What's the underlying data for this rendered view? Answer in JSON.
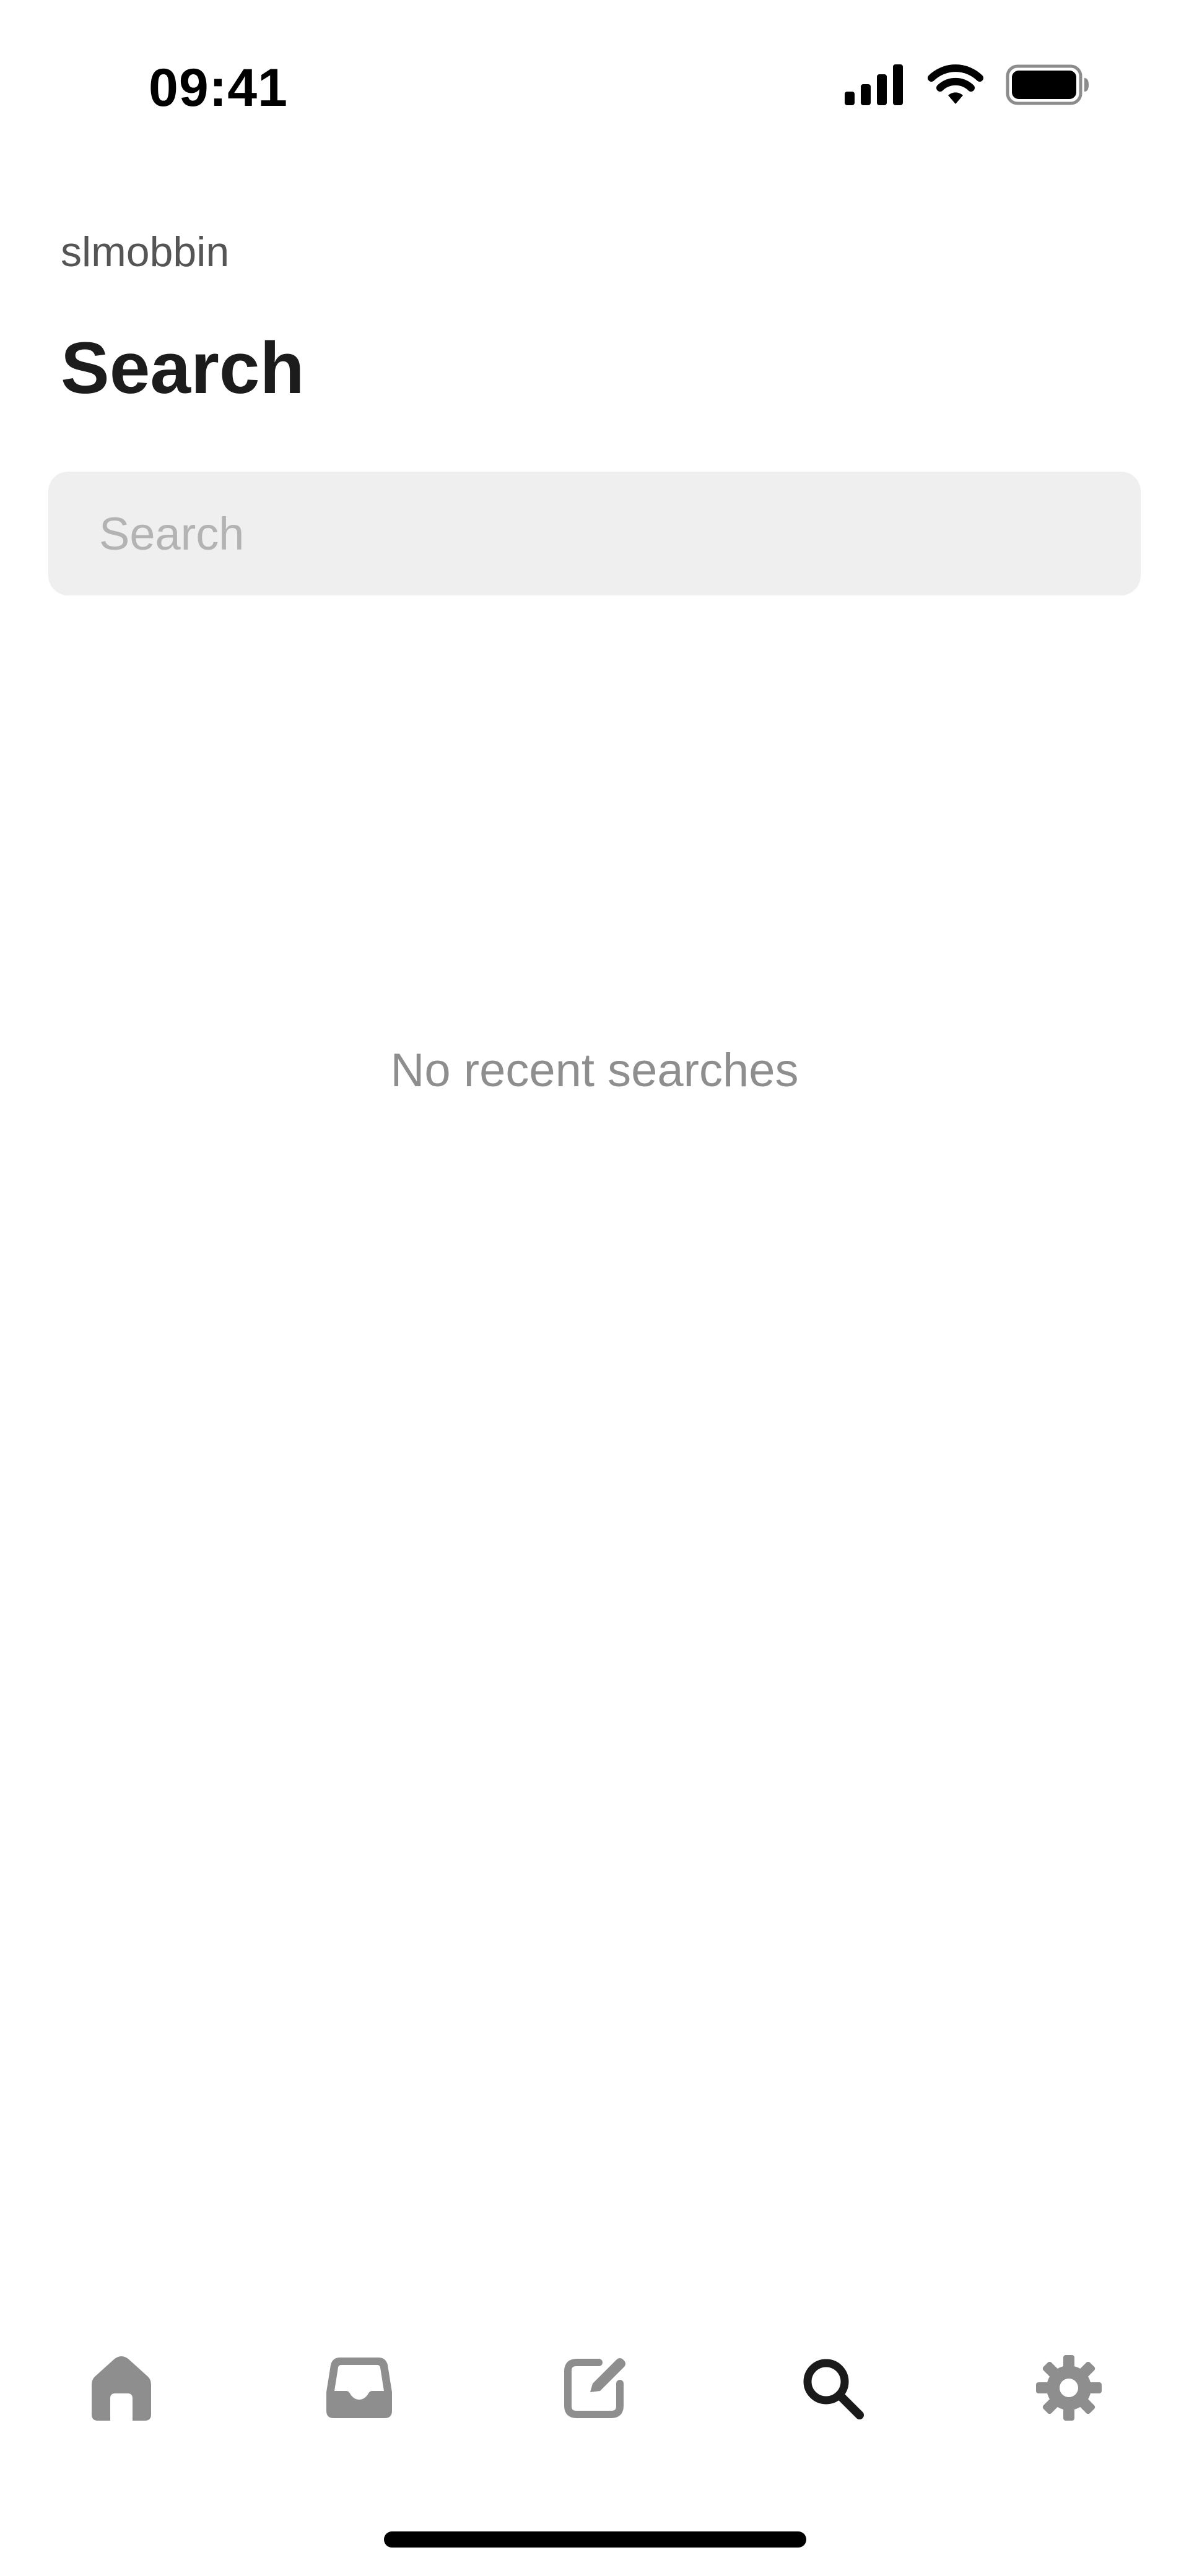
{
  "status_bar": {
    "time": "09:41"
  },
  "header": {
    "username": "slmobbin",
    "title": "Search"
  },
  "search": {
    "placeholder": "Search",
    "value": ""
  },
  "empty_state": {
    "message": "No recent searches"
  },
  "tab_bar": {
    "items": [
      {
        "icon": "home-icon",
        "active": false
      },
      {
        "icon": "inbox-icon",
        "active": false
      },
      {
        "icon": "compose-icon",
        "active": false
      },
      {
        "icon": "search-icon",
        "active": true
      },
      {
        "icon": "gear-icon",
        "active": false
      }
    ],
    "colors": {
      "active": "#1a1a1a",
      "inactive": "#8e8e8e"
    }
  }
}
